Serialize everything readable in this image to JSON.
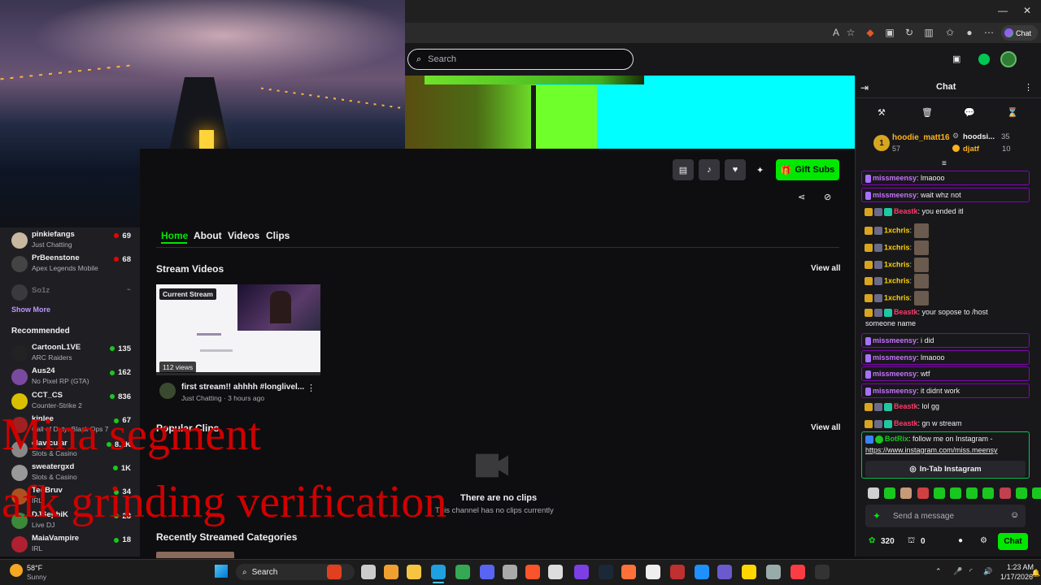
{
  "browser": {
    "chat_pill": "Chat",
    "window_buttons": [
      "—",
      "❐",
      "✕"
    ]
  },
  "topbar": {
    "search_placeholder": "Search"
  },
  "channel_actions": {
    "gift_subs": "Gift Subs"
  },
  "tabs": [
    "Home",
    "About",
    "Videos",
    "Clips"
  ],
  "sidebar": {
    "following": [
      {
        "name": "pinkiefangs",
        "category": "Just Chatting",
        "viewers": "69",
        "color": "#c9b8a0"
      },
      {
        "name": "PrBeenstone",
        "category": "Apex Legends Mobile",
        "viewers": "68",
        "color": "#444"
      },
      {
        "name": "So1z",
        "category": "",
        "viewers": "",
        "color": "#555"
      }
    ],
    "show_more": "Show More",
    "recommended_title": "Recommended",
    "recommended": [
      {
        "name": "CartoonL1VE",
        "category": "ARC Raiders",
        "viewers": "135",
        "color": "#222"
      },
      {
        "name": "Aus24",
        "category": "No Pixel RP (GTA)",
        "viewers": "162",
        "color": "#7a4aa0"
      },
      {
        "name": "CCT_CS",
        "category": "Counter-Strike 2",
        "viewers": "836",
        "color": "#d8c000"
      },
      {
        "name": "kinlee",
        "category": "Call of Duty: Black Ops 7",
        "viewers": "67",
        "color": "#a02020"
      },
      {
        "name": "clavicular",
        "category": "Slots & Casino",
        "viewers": "8.1K",
        "color": "#888"
      },
      {
        "name": "sweatergxd",
        "category": "Slots & Casino",
        "viewers": "1K",
        "color": "#999"
      },
      {
        "name": "TedBruv",
        "category": "IRL",
        "viewers": "34",
        "color": "#b05020"
      },
      {
        "name": "DJSephiK",
        "category": "Live DJ",
        "viewers": "28",
        "color": "#3a8a3a"
      },
      {
        "name": "MaiaVampire",
        "category": "IRL",
        "viewers": "18",
        "color": "#b02030"
      }
    ]
  },
  "main": {
    "stream_videos_title": "Stream Videos",
    "view_all": "View all",
    "video": {
      "badge": "Current Stream",
      "views": "112 views",
      "title": "first stream!! ahhhh #longlivel...",
      "meta": "Just Chatting · 3 hours ago"
    },
    "popular_clips_title": "Popular Clips",
    "no_clips_title": "There are no clips",
    "no_clips_sub": "This channel has no clips currently",
    "recent_categories_title": "Recently Streamed Categories"
  },
  "overlay": {
    "line1": "Mina segment",
    "line2": "afk grinding verification"
  },
  "chat": {
    "title": "Chat",
    "leaderboard": [
      {
        "rank": "1",
        "name": "hoodie_matt16",
        "score": "57"
      },
      {
        "name": "hoodsi...",
        "score": "35"
      },
      {
        "name": "djatf",
        "score": "10"
      }
    ],
    "messages": [
      {
        "user": "missmeensy",
        "text": ": lmaooo",
        "color": "#c772ff",
        "hl": true
      },
      {
        "user": "missmeensy",
        "text": ": wait whz not",
        "color": "#c772ff",
        "hl": true
      },
      {
        "user": "Beastk",
        "text": ": you ended itl",
        "color": "#ff3b6b",
        "hl": false
      },
      {
        "user": "1xchris",
        "text": ":",
        "color": "#ffd200",
        "hl": false,
        "emote": true
      },
      {
        "user": "1xchris",
        "text": ":",
        "color": "#ffd200",
        "hl": false,
        "emote": true
      },
      {
        "user": "1xchris",
        "text": ":",
        "color": "#ffd200",
        "hl": false,
        "emote": true
      },
      {
        "user": "1xchris",
        "text": ":",
        "color": "#ffd200",
        "hl": false,
        "emote": true
      },
      {
        "user": "1xchris",
        "text": ":",
        "color": "#ffd200",
        "hl": false,
        "emote": true
      },
      {
        "user": "Beastk",
        "text": ": your sopose to /host",
        "color": "#ff3b6b",
        "hl": false,
        "cont": "someone name"
      },
      {
        "user": "missmeensy",
        "text": ": i did",
        "color": "#c772ff",
        "hl": true
      },
      {
        "user": "missmeensy",
        "text": ": lmaooo",
        "color": "#c772ff",
        "hl": true
      },
      {
        "user": "missmeensy",
        "text": ": wtf",
        "color": "#c772ff",
        "hl": true
      },
      {
        "user": "missmeensy",
        "text": ": it didnt work",
        "color": "#c772ff",
        "hl": true
      },
      {
        "user": "Beastk",
        "text": ": lol gg",
        "color": "#ff3b6b",
        "hl": false
      },
      {
        "user": "Beastk",
        "text": ": gn w stream",
        "color": "#ff3b6b",
        "hl": false
      }
    ],
    "bot": {
      "user": "BotRix",
      "text": ": follow me on Instagram -",
      "link": "https://www.instagram.com/miss.meensy",
      "button": "In-Tab Instagram"
    },
    "input_placeholder": "Send a message",
    "points": "320",
    "gifts": "0",
    "send_label": "Chat"
  },
  "taskbar": {
    "weather_temp": "58°F",
    "weather_desc": "Sunny",
    "search_label": "Search",
    "time": "1:23 AM",
    "date": "1/17/2026"
  },
  "colors": {
    "twitch_green": "#00e700",
    "highlight_border": "#8205b4",
    "overlay_red": "#d00000"
  }
}
